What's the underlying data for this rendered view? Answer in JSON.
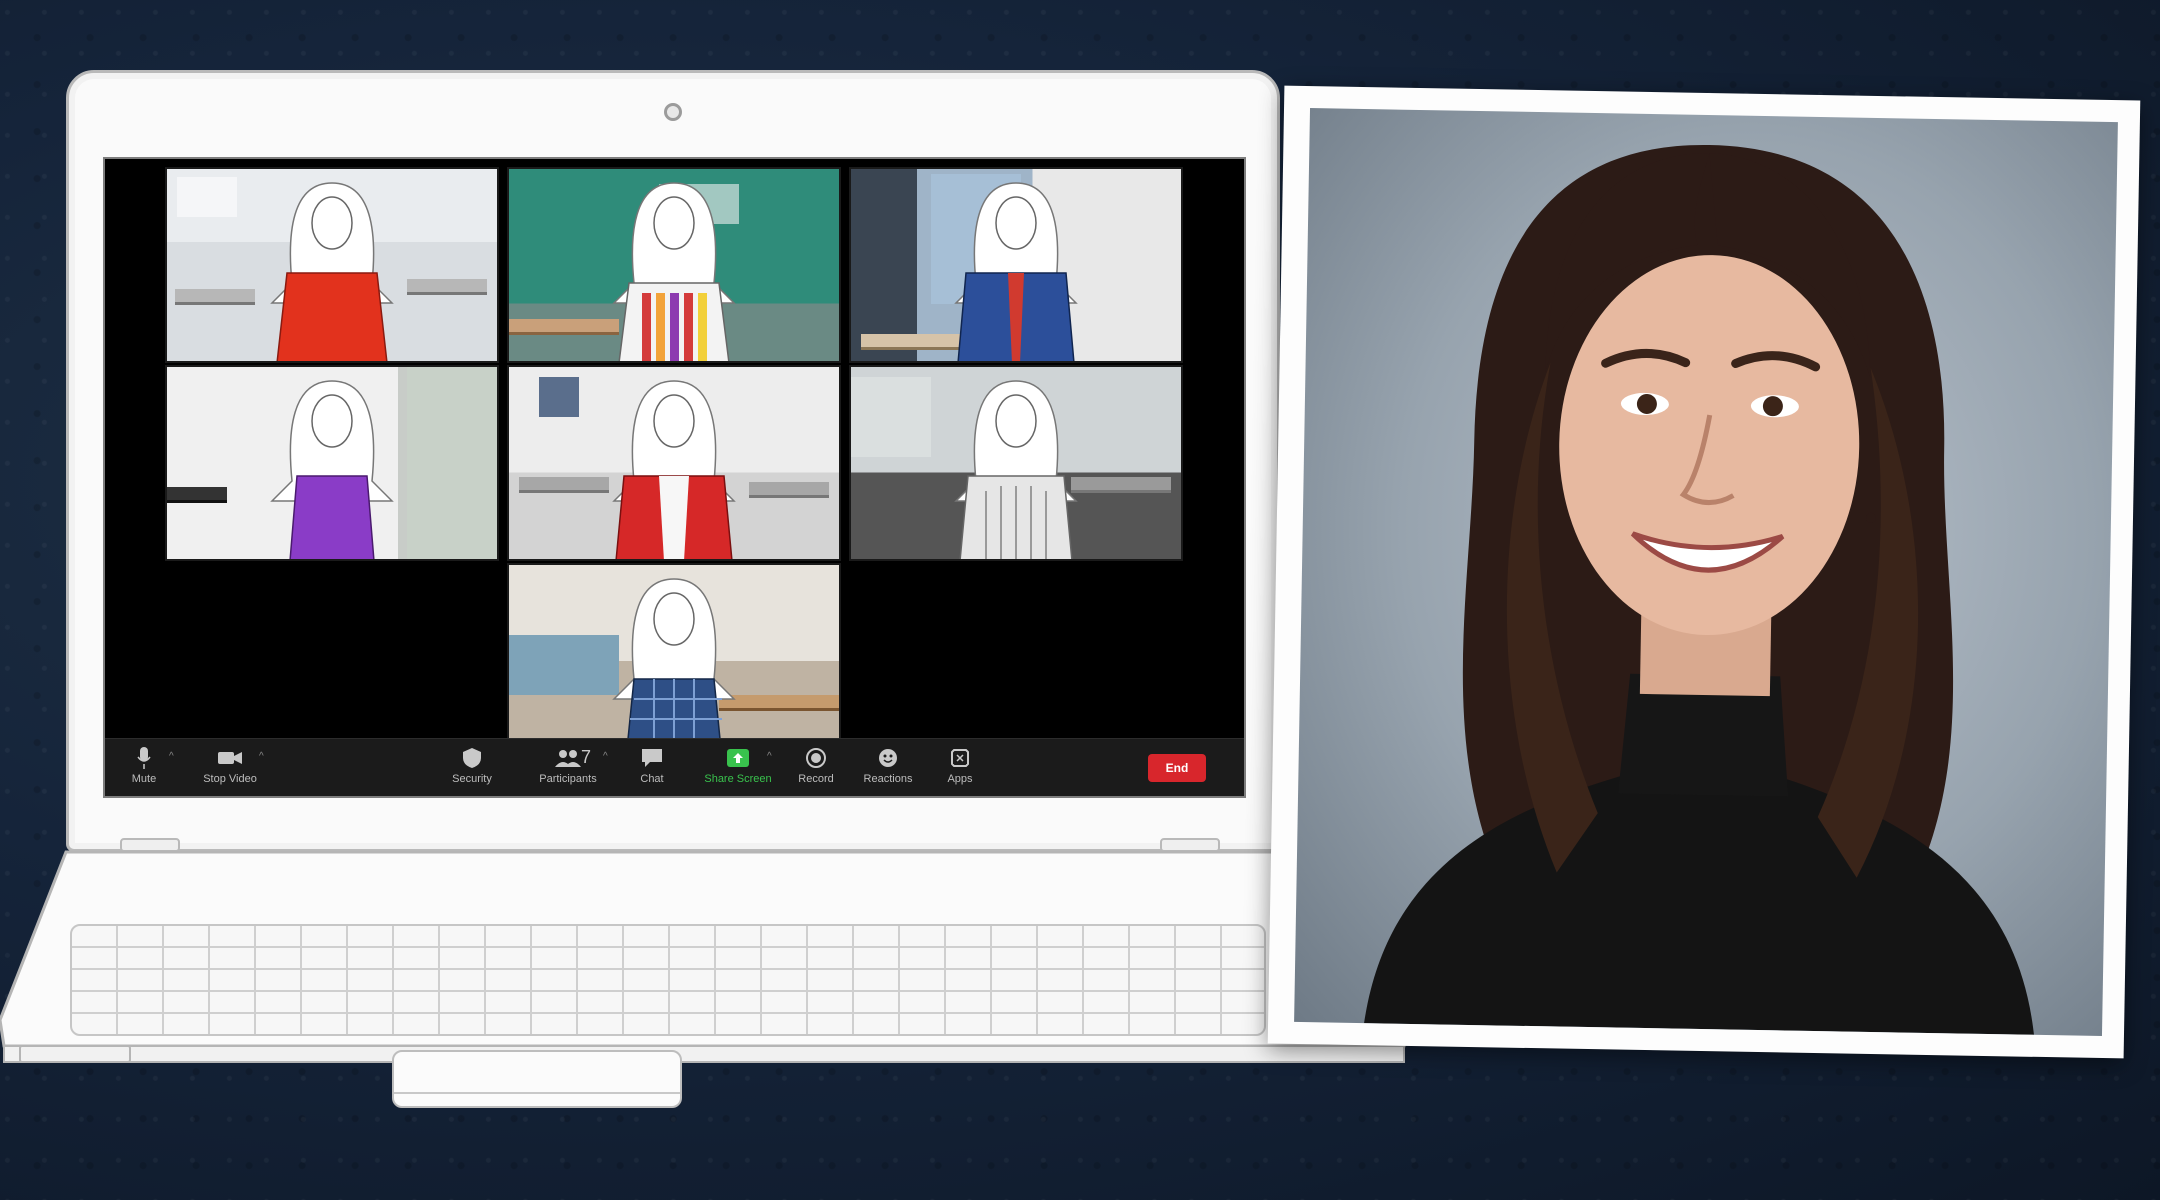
{
  "zoom": {
    "participants": 7,
    "toolbar": {
      "mute": "Mute",
      "stop_video": "Stop Video",
      "security": "Security",
      "participants": "Participants",
      "participant_count": "7",
      "chat": "Chat",
      "share_screen": "Share Screen",
      "record": "Record",
      "reactions": "Reactions",
      "apps": "Apps",
      "end": "End"
    },
    "colors": {
      "toolbar_bg": "#1b1b1b",
      "share_green": "#39c24d",
      "end_red": "#d8262c"
    }
  },
  "icons": [
    "microphone-icon",
    "video-camera-icon",
    "shield-icon",
    "participants-icon",
    "chat-icon",
    "share-screen-icon",
    "record-icon",
    "reactions-icon",
    "apps-icon"
  ]
}
